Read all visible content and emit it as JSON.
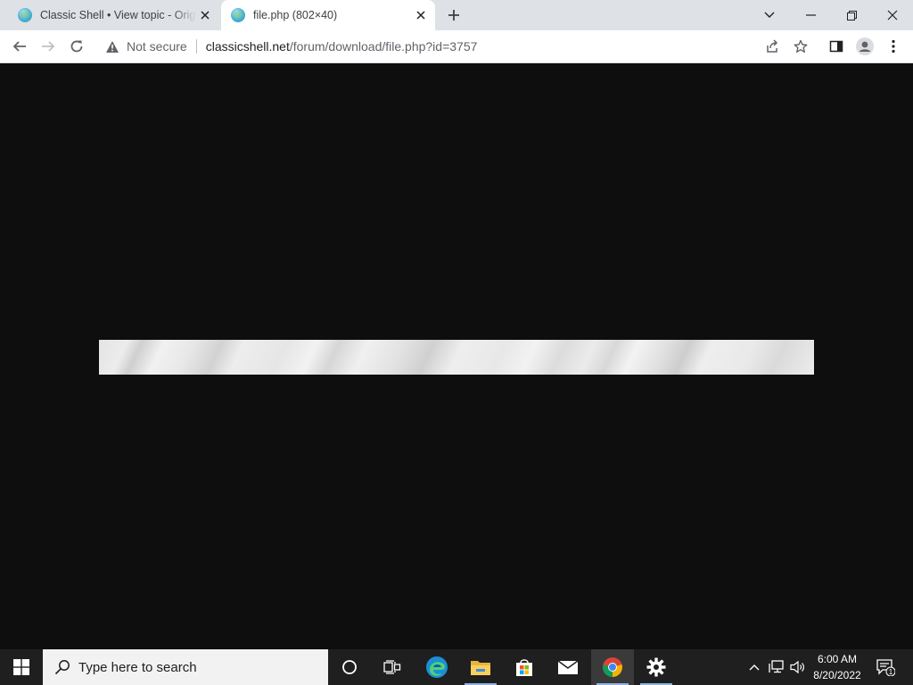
{
  "browser": {
    "tabs": [
      {
        "title": "Classic Shell • View topic - Original Classic Shell installers",
        "active": false
      },
      {
        "title": "file.php (802×40)",
        "active": true
      }
    ],
    "omnibox": {
      "security_label": "Not secure",
      "url_host": "classicshell.net",
      "url_path": "/forum/download/file.php?id=3757"
    }
  },
  "taskbar": {
    "search_placeholder": "Type here to search",
    "apps": [
      "cortana-icon",
      "task-view-icon",
      "edge-icon",
      "file-explorer-icon",
      "store-icon",
      "mail-icon",
      "chrome-icon",
      "settings-icon"
    ],
    "clock_time": "6:00 AM",
    "clock_date": "8/20/2022",
    "notification_count": "1"
  },
  "colors": {
    "page_background": "#0e0e0e",
    "tabbar_background": "#dee1e6",
    "taskbar_background": "#1f1f1f"
  }
}
